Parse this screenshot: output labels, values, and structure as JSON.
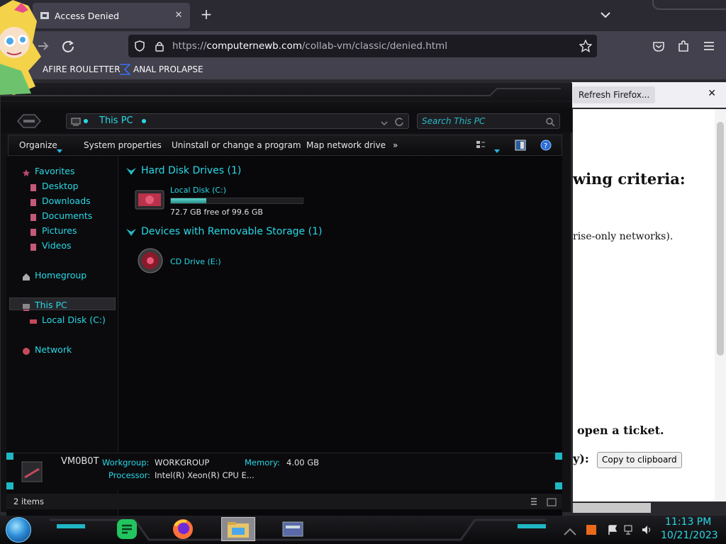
{
  "browser": {
    "tab_title": "Access Denied",
    "tab_close": "✕",
    "new_tab": "+",
    "url_prefix": "https://",
    "url_domain": "computernewb.com",
    "url_path": "/collab-vm/classic/denied.html",
    "bookmarks": [
      "AFIRE ROULETTER",
      "ANAL PROLAPSE"
    ],
    "notification_button": "Refresh Firefox...",
    "notification_close": "✕",
    "page_texts": [
      "wing criteria:",
      "rise-only networks).",
      "open a ticket.",
      "y):"
    ],
    "copy_button": "Copy to clipboard"
  },
  "explorer": {
    "address": "This PC",
    "search_placeholder": "Search This PC",
    "commands": [
      "Organize",
      "System properties",
      "Uninstall or change a program",
      "Map network drive",
      "»"
    ],
    "nav": {
      "favorites": "Favorites",
      "favorites_items": [
        "Desktop",
        "Downloads",
        "Documents",
        "Pictures",
        "Videos"
      ],
      "homegroup": "Homegroup",
      "this_pc": "This PC",
      "local_disk": "Local Disk (C:)",
      "network": "Network"
    },
    "groups": {
      "hard_disk": "Hard Disk Drives (1)",
      "removable": "Devices with Removable Storage (1)"
    },
    "drives": {
      "c_name": "Local Disk (C:)",
      "c_free": "72.7 GB free of 99.6 GB",
      "c_used_fraction": 0.27,
      "e_name": "CD Drive (E:)"
    },
    "details": {
      "computer_name": "VM0B0T",
      "workgroup_label": "Workgroup:",
      "workgroup": "WORKGROUP",
      "memory_label": "Memory:",
      "memory": "4.00 GB",
      "processor_label": "Processor:",
      "processor": "Intel(R) Xeon(R) CPU E..."
    },
    "status": "2 items"
  },
  "taskbar": {
    "time": "11:13 PM",
    "date": "10/21/2023"
  },
  "colors": {
    "accent_cyan": "#29d8e6",
    "browser_chrome": "#42414d",
    "explorer_bg": "#08080a"
  }
}
